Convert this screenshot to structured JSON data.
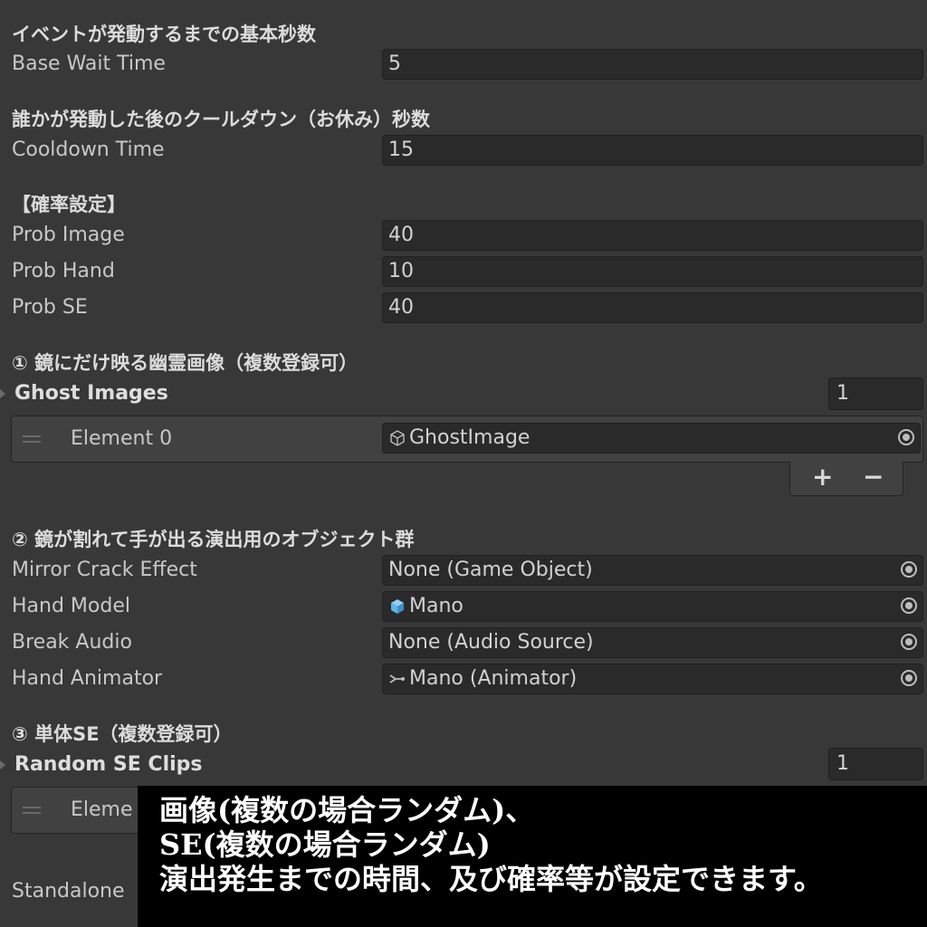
{
  "section_base": {
    "header": "イベントが発動するまでの基本秒数",
    "label": "Base Wait Time",
    "value": "5"
  },
  "section_cooldown": {
    "header": "誰かが発動した後のクールダウン（お休み）秒数",
    "label": "Cooldown Time",
    "value": "15"
  },
  "section_prob": {
    "header": "【確率設定】",
    "rows": [
      {
        "label": "Prob Image",
        "value": "40"
      },
      {
        "label": "Prob Hand",
        "value": "10"
      },
      {
        "label": "Prob SE",
        "value": "40"
      }
    ]
  },
  "section_ghost": {
    "header": "① 鏡にだけ映る幽霊画像（複数登録可）",
    "list_label": "Ghost Images",
    "count": "1",
    "element_label": "Element 0",
    "element_value": "GhostImage",
    "element_icon": "prefab-icon",
    "add_label": "+",
    "remove_label": "−"
  },
  "section_mirror": {
    "header": "② 鏡が割れて手が出る演出用のオブジェクト群",
    "rows": [
      {
        "label": "Mirror Crack Effect",
        "value": "None (Game Object)",
        "icon": ""
      },
      {
        "label": "Hand Model",
        "value": "Mano",
        "icon": "model-cube-icon"
      },
      {
        "label": "Break Audio",
        "value": "None (Audio Source)",
        "icon": ""
      },
      {
        "label": "Hand Animator",
        "value": "Mano (Animator)",
        "icon": "animator-icon"
      }
    ]
  },
  "section_se": {
    "header": "③ 単体SE（複数登録可）",
    "list_label": "Random SE Clips",
    "count": "1",
    "element_label": "Eleme",
    "standalone_label": "Standalone"
  },
  "overlay": {
    "line1": "画像(複数の場合ランダム)、",
    "line2": "SE(複数の場合ランダム)",
    "line3": "演出発生までの時間、及び確率等が設定できます。"
  },
  "colors": {
    "background": "#383838",
    "field": "#2a2a2a",
    "list": "#414141",
    "overlay": "#000000",
    "model_icon": "#5fb3e6"
  }
}
